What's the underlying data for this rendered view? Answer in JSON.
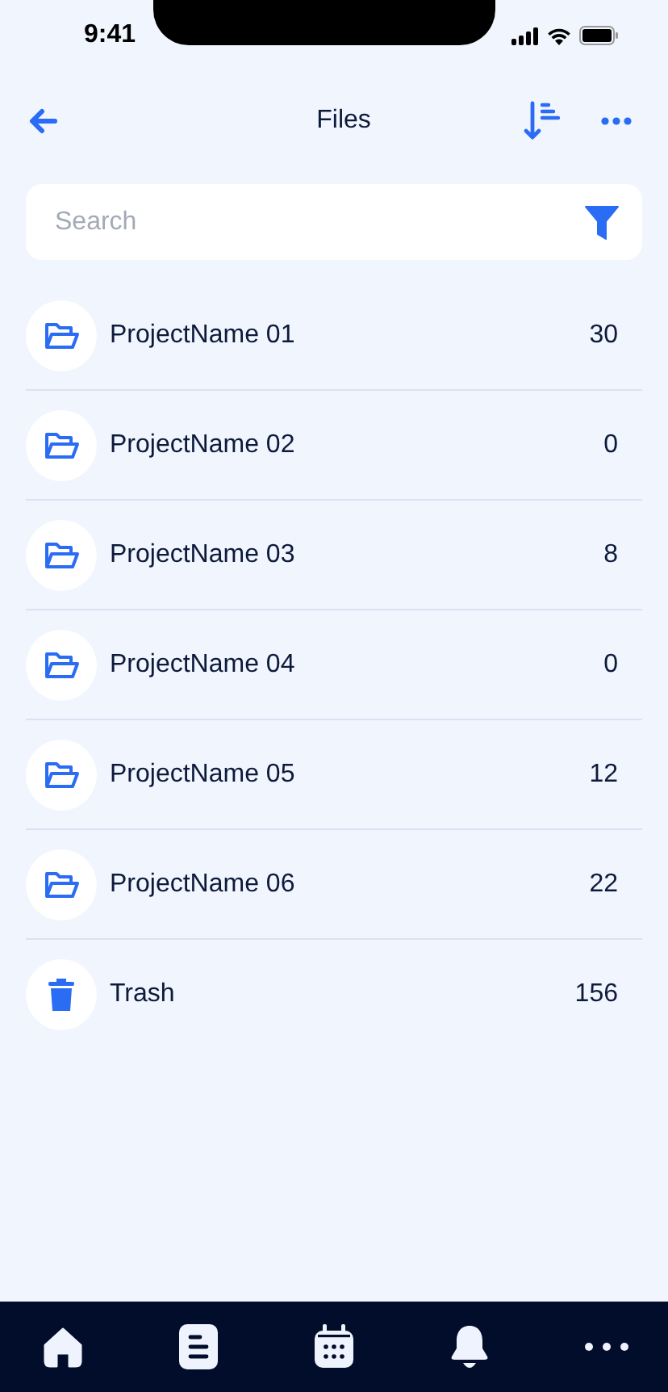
{
  "status_bar": {
    "time": "9:41"
  },
  "header": {
    "title": "Files"
  },
  "search": {
    "placeholder": "Search"
  },
  "items": [
    {
      "kind": "folder",
      "name": "ProjectName 01",
      "count": "30"
    },
    {
      "kind": "folder",
      "name": "ProjectName 02",
      "count": "0"
    },
    {
      "kind": "folder",
      "name": "ProjectName 03",
      "count": "8"
    },
    {
      "kind": "folder",
      "name": "ProjectName 04",
      "count": "0"
    },
    {
      "kind": "folder",
      "name": "ProjectName 05",
      "count": "12"
    },
    {
      "kind": "folder",
      "name": "ProjectName 06",
      "count": "22"
    },
    {
      "kind": "trash",
      "name": "Trash",
      "count": "156"
    }
  ],
  "nav": [
    {
      "kind": "home"
    },
    {
      "kind": "document"
    },
    {
      "kind": "calendar"
    },
    {
      "kind": "bell"
    },
    {
      "kind": "more"
    }
  ]
}
